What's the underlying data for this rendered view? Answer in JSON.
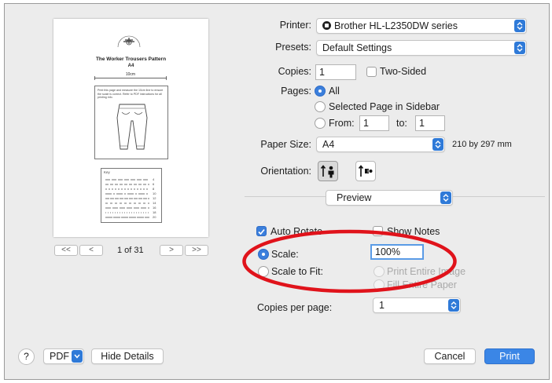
{
  "preview": {
    "pattern_title": "The Worker Trousers Pattern",
    "paper_label": "A4",
    "measure_label": "10cm",
    "instructions_text": "Print this page and measure the 10cm line to ensure the scale is correct. Refer to PDF instructions for all printing info.",
    "key_title": "Key",
    "key_sizes": [
      "4",
      "6",
      "8",
      "10",
      "12",
      "14",
      "16",
      "18",
      "20"
    ],
    "page_indicator": "1 of 31",
    "first_glyph": "<<",
    "prev_glyph": "<",
    "next_glyph": ">",
    "last_glyph": ">>"
  },
  "printer": {
    "label": "Printer:",
    "value": "Brother HL-L2350DW series"
  },
  "presets": {
    "label": "Presets:",
    "value": "Default Settings"
  },
  "copies": {
    "label": "Copies:",
    "value": "1",
    "two_sided_label": "Two-Sided",
    "two_sided_checked": false
  },
  "pages": {
    "label": "Pages:",
    "all_label": "All",
    "selected_label": "Selected Page in Sidebar",
    "from_label": "From:",
    "from_value": "1",
    "to_label": "to:",
    "to_value": "1",
    "selected_option": "All"
  },
  "paper_size": {
    "label": "Paper Size:",
    "value": "A4",
    "dimensions": "210 by 297 mm"
  },
  "orientation": {
    "label": "Orientation:",
    "selected": "portrait"
  },
  "section_popup": {
    "value": "Preview"
  },
  "preview_options": {
    "auto_rotate_label": "Auto Rotate",
    "auto_rotate_checked": true,
    "show_notes_label": "Show Notes",
    "show_notes_checked": false,
    "scale_label": "Scale:",
    "scale_value": "100%",
    "scale_to_fit_label": "Scale to Fit:",
    "print_entire_image_label": "Print Entire Image",
    "fill_entire_paper_label": "Fill Entire Paper",
    "selected_scaling": "Scale"
  },
  "copies_per_page": {
    "label": "Copies per page:",
    "value": "1"
  },
  "footer": {
    "help_label": "?",
    "pdf_label": "PDF",
    "hide_details_label": "Hide Details",
    "cancel_label": "Cancel",
    "print_label": "Print"
  },
  "colors": {
    "accent": "#3b7fdc",
    "highlight_ring": "#e0131b"
  }
}
